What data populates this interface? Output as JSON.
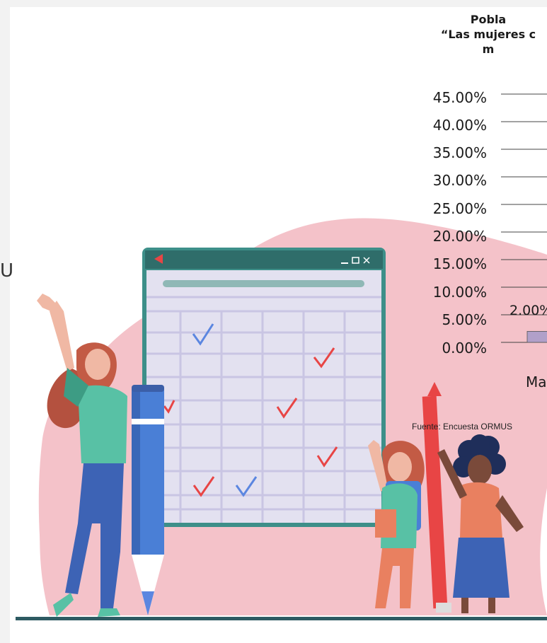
{
  "chart_data": {
    "type": "bar",
    "title_lines": [
      "Pobla",
      "“Las mujeres c",
      "m"
    ],
    "y_ticks": [
      "45.00%",
      "40.00%",
      "35.00%",
      "30.00%",
      "25.00%",
      "20.00%",
      "15.00%",
      "10.00%",
      "5.00%",
      "0.00%"
    ],
    "ylim": [
      0,
      45
    ],
    "categories": [
      "Ma"
    ],
    "values": [
      2.0
    ],
    "data_labels": [
      "2.00%"
    ],
    "bar_color": "#b1a0c9",
    "grid": true
  },
  "source_text": "Fuente: Encuesta ORMUS",
  "edge_text": "U",
  "colors": {
    "blob": "#f4c2c9",
    "window_frame": "#3d8f89",
    "window_title": "#2f6d6a",
    "window_body": "#e3e1f0",
    "grid_line": "#c9c5e3",
    "check_red": "#e84545",
    "check_blue": "#5b86e0",
    "ground": "#2d5a62"
  }
}
